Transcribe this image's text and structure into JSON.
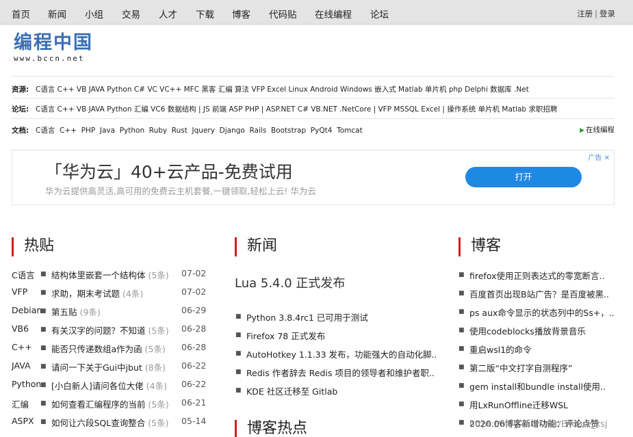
{
  "nav": {
    "items": [
      "首页",
      "新闻",
      "小组",
      "交易",
      "人才",
      "下载",
      "博客",
      "代码贴",
      "在线编程",
      "论坛"
    ],
    "register": "注册",
    "separator": "|",
    "login": "登录"
  },
  "logo": {
    "name": "编程中国",
    "url": "www.bccn.net"
  },
  "resources": {
    "label": "资源:",
    "text": "C语言 C++ VB JAVA Python C# VC VC++ MFC 黑客 汇编 算法 VFP Excel Linux Android Windows 嵌入式 Matlab 单片机 php Delphi 数据库 .Net"
  },
  "forum": {
    "label": "论坛:",
    "text": "C语言 C++ VB JAVA Python 汇编 VC6 数据结构 | JS 前端 ASP PHP | ASP.NET C# VB.NET .NetCore | VFP MSSQL Excel | 操作系统 单片机 Matlab 求职招聘"
  },
  "docs": {
    "label": "文档:",
    "text": "C语言  C++  PHP  Java  Python  Ruby  Rust  Jquery  Django  Rails  Bootstrap  PyQt4  Tomcat",
    "online_label": "在线编程"
  },
  "ad": {
    "headline": "「华为云」40+云产品-免费试用",
    "sub": "华为云提供高灵活,高可用的免费云主机套餐,一键领取,轻松上云! 华为云",
    "button": "打开",
    "tag": "广告 ✕"
  },
  "hot": {
    "title": "热贴",
    "rows": [
      {
        "cat": "C语言",
        "title": "结构体里嵌套一个结构体",
        "count": "(5条)",
        "date": "07-02"
      },
      {
        "cat": "VFP",
        "title": "求助，期末考试题",
        "count": "(4条)",
        "date": "07-02"
      },
      {
        "cat": "Debian",
        "title": "第五贴",
        "count": "(9条)",
        "date": "06-29"
      },
      {
        "cat": "VB6",
        "title": "有关汉字的问题？不知道",
        "count": "(5条)",
        "date": "06-28"
      },
      {
        "cat": "C++",
        "title": "能否只传递数组a作为函",
        "count": "(5条)",
        "date": "06-28"
      },
      {
        "cat": "JAVA",
        "title": "请问一下关于Gui中jbut",
        "count": "(8条)",
        "date": "06-22"
      },
      {
        "cat": "Python",
        "title": "[小白新人]请问各位大佬",
        "count": "(4条)",
        "date": "06-22"
      },
      {
        "cat": "汇编",
        "title": "如何查看汇编程序的当前",
        "count": "(5条)",
        "date": "06-21"
      },
      {
        "cat": "ASPX",
        "title": "如何让六段SQL查询整合",
        "count": "(5条)",
        "date": "05-14"
      }
    ]
  },
  "news": {
    "title": "新闻",
    "lead": "Lua 5.4.0 正式发布",
    "items": [
      "Python 3.8.4rc1 已可用于测试",
      "Firefox 78 正式发布",
      "AutoHotkey 1.1.33 发布，功能强大的自动化脚..",
      "Redis 作者辞去 Redis 项目的领导者和维护者职..",
      "KDE 社区迁移至 Gitlab"
    ]
  },
  "blog": {
    "title": "博客",
    "items": [
      "firefox使用正则表达式的零宽断言..",
      "百度首页出现B站广告？是百度被黑..",
      "ps aux命令显示的状态列中的Ss+，..",
      "使用codeblocks播放背景音乐",
      "重启wsl1的命令",
      "第二版“中文打字自测程序”",
      "gem install和bundle install使用..",
      "用LxRunOffline迁移WSL",
      "2020.06博客新增功能：评论点赞"
    ]
  },
  "blog_hot": {
    "title": "博客热点"
  },
  "watermark": "https://blog.csdn.net/Endure_ksj"
}
